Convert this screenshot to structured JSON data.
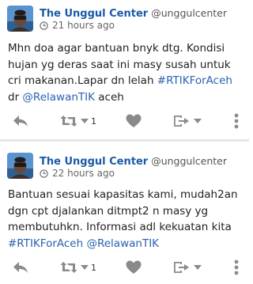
{
  "tweets": [
    {
      "display_name": "The Unggul Center",
      "handle": "@unggulcenter",
      "time": "21 hours ago",
      "text_parts": [
        {
          "text": "Mhn doa agar bantuan bnyk dtg. Kondisi hujan yg deras saat ini masy susah untuk cri makanan.Lapar dn lelah ",
          "link": false
        },
        {
          "text": "#RTIKForAceh",
          "link": true
        },
        {
          "text": " dr ",
          "link": false
        },
        {
          "text": "@RelawanTIK",
          "link": true
        },
        {
          "text": " aceh",
          "link": false
        }
      ],
      "retweet_count": "1",
      "icons": [
        "avatar",
        "clock-icon",
        "reply-icon",
        "retweet-icon",
        "chevron-down-icon",
        "heart-icon",
        "share-icon",
        "chevron-down-icon",
        "more-vertical-icon"
      ]
    },
    {
      "display_name": "The Unggul Center",
      "handle": "@unggulcenter",
      "time": "22 hours ago",
      "text_parts": [
        {
          "text": "Bantuan sesuai kapasitas kami, mudah2an dgn cpt djalankan ditmpt2 n masy yg membutuhkn. Informasi adl kekuatan kita ",
          "link": false
        },
        {
          "text": "#RTIKForAceh",
          "link": true
        },
        {
          "text": " ",
          "link": false
        },
        {
          "text": "@RelawanTIK",
          "link": true
        }
      ],
      "retweet_count": "1",
      "icons": [
        "avatar",
        "clock-icon",
        "reply-icon",
        "retweet-icon",
        "chevron-down-icon",
        "heart-icon",
        "share-icon",
        "chevron-down-icon",
        "more-vertical-icon"
      ]
    }
  ],
  "colors": {
    "name": "#1a5aa6",
    "link": "#2a62b0",
    "icon": "#8a8a8a",
    "divider": "#e6e6e6"
  }
}
